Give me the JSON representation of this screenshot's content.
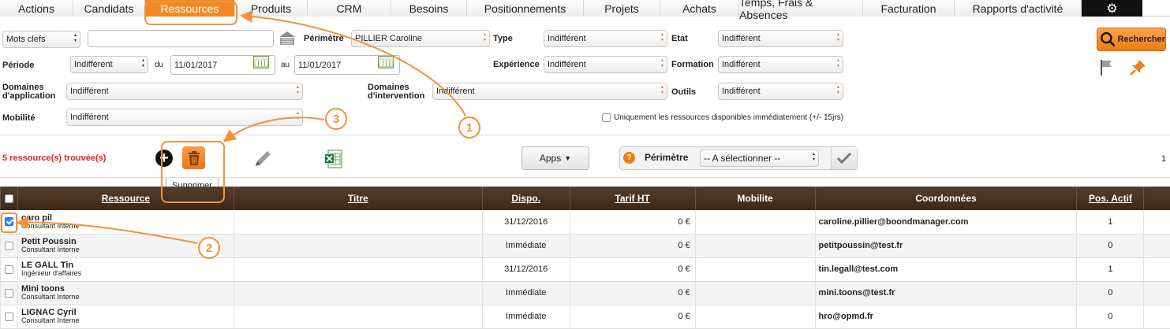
{
  "nav": {
    "tabs": [
      "Actions",
      "Candidats",
      "Ressources",
      "Produits",
      "CRM",
      "Besoins",
      "Positionnements",
      "Projets",
      "Achats",
      "Temps, Frais & Absences",
      "Facturation",
      "Rapports d'activité"
    ],
    "active": "Ressources",
    "gear_icon": "gear-icon"
  },
  "search": {
    "keyword_type": "Mots clefs",
    "keyword_value": "",
    "perimetre_label": "Périmètre",
    "perimetre_value": "PILLIER Caroline",
    "type_label": "Type",
    "type_value": "Indifférent",
    "etat_label": "Etat",
    "etat_value": "Indifférent",
    "periode_label": "Période",
    "periode_value": "Indifférent",
    "du_label": "du",
    "du_value": "11/01/2017",
    "au_label": "au",
    "au_value": "11/01/2017",
    "experience_label": "Expérience",
    "experience_value": "Indifférent",
    "formation_label": "Formation",
    "formation_value": "Indifférent",
    "domaines_app_label_1": "Domaines",
    "domaines_app_label_2": "d'application",
    "domaines_app_value": "Indifférent",
    "domaines_int_label_1": "Domaines",
    "domaines_int_label_2": "d'intervention",
    "domaines_int_value": "Indifférent",
    "outils_label": "Outils",
    "outils_value": "Indifférent",
    "mobilite_label": "Mobilité",
    "mobilite_value": "Indifférent",
    "dispo_checkbox_label": "Uniquement les ressources disponibles immédiatement (+/- 15jrs)",
    "search_button": "Rechercher"
  },
  "results": {
    "count_text": "5 ressource(s) trouvée(s)",
    "delete_tooltip": "Supprimer",
    "apps_button": "Apps",
    "perimetre_label": "Périmètre",
    "perimetre_select": "-- A sélectionner --",
    "page_number": "1"
  },
  "table": {
    "headers": [
      "Ressource",
      "Titre",
      "Dispo.",
      "Tarif HT",
      "Mobilite",
      "Coordonnées",
      "Pos. Actif"
    ],
    "rows": [
      {
        "name": "caro pil",
        "role": "Consultant Interne",
        "titre": "",
        "dispo": "31/12/2016",
        "tarif": "0 €",
        "mobilite": "",
        "email": "caroline.pillier@boondmanager.com",
        "pos": "1",
        "checked": true
      },
      {
        "name": "Petit Poussin",
        "role": "Consultant Interne",
        "titre": "",
        "dispo": "Immédiate",
        "tarif": "0 €",
        "mobilite": "",
        "email": "petitpoussin@test.fr",
        "pos": "0",
        "checked": false
      },
      {
        "name": "LE GALL Tin",
        "role": "Ingénieur d'affaires",
        "titre": "",
        "dispo": "31/12/2016",
        "tarif": "0 €",
        "mobilite": "",
        "email": "tin.legall@test.com",
        "pos": "1",
        "checked": false
      },
      {
        "name": "Mini toons",
        "role": "Consultant Interne",
        "titre": "",
        "dispo": "Immédiate",
        "tarif": "0 €",
        "mobilite": "",
        "email": "mini.toons@test.fr",
        "pos": "0",
        "checked": false
      },
      {
        "name": "LIGNAC Cyril",
        "role": "Consultant Interne",
        "titre": "",
        "dispo": "Immédiate",
        "tarif": "0 €",
        "mobilite": "",
        "email": "hro@opmd.fr",
        "pos": "0",
        "checked": false
      }
    ]
  },
  "annotations": {
    "step1": "1",
    "step2": "2",
    "step3": "3",
    "color": "#f0923a"
  }
}
